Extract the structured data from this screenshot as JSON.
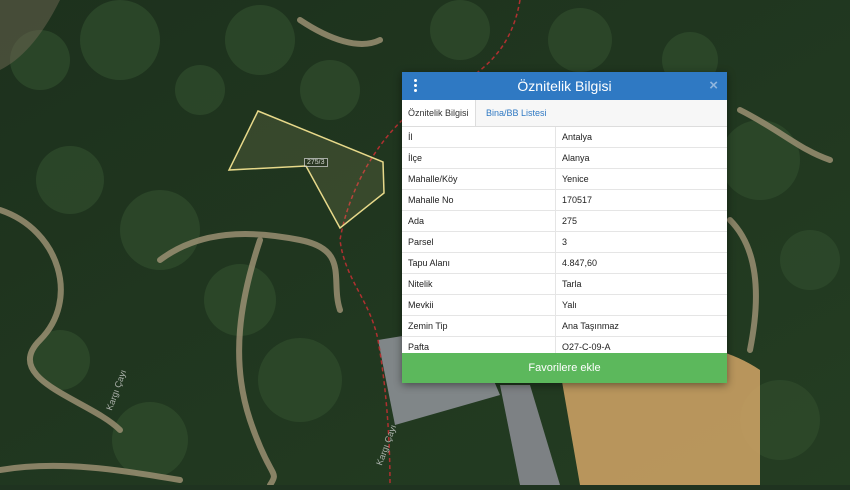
{
  "panel": {
    "title": "Öznitelik Bilgisi",
    "close": "×",
    "tabs": [
      "Öznitelik Bilgisi",
      "Bina/BB Listesi"
    ],
    "rows": [
      {
        "key": "İl",
        "value": "Antalya"
      },
      {
        "key": "İlçe",
        "value": "Alanya"
      },
      {
        "key": "Mahalle/Köy",
        "value": "Yenice"
      },
      {
        "key": "Mahalle No",
        "value": "170517"
      },
      {
        "key": "Ada",
        "value": "275"
      },
      {
        "key": "Parsel",
        "value": "3"
      },
      {
        "key": "Tapu Alanı",
        "value": "4.847,60"
      },
      {
        "key": "Nitelik",
        "value": "Tarla"
      },
      {
        "key": "Mevkii",
        "value": "Yalı"
      },
      {
        "key": "Zemin Tip",
        "value": "Ana Taşınmaz"
      },
      {
        "key": "Pafta",
        "value": "O27-C-09-A"
      }
    ],
    "favorite_label": "Favorilere ekle"
  },
  "map": {
    "parcel_label": "275/3",
    "road_labels": [
      "Kargı Çayı",
      "Kargı Çayı"
    ]
  },
  "colors": {
    "header": "#2f79c3",
    "favorite": "#5cb85c",
    "parcel_outline": "#e7d98a"
  }
}
